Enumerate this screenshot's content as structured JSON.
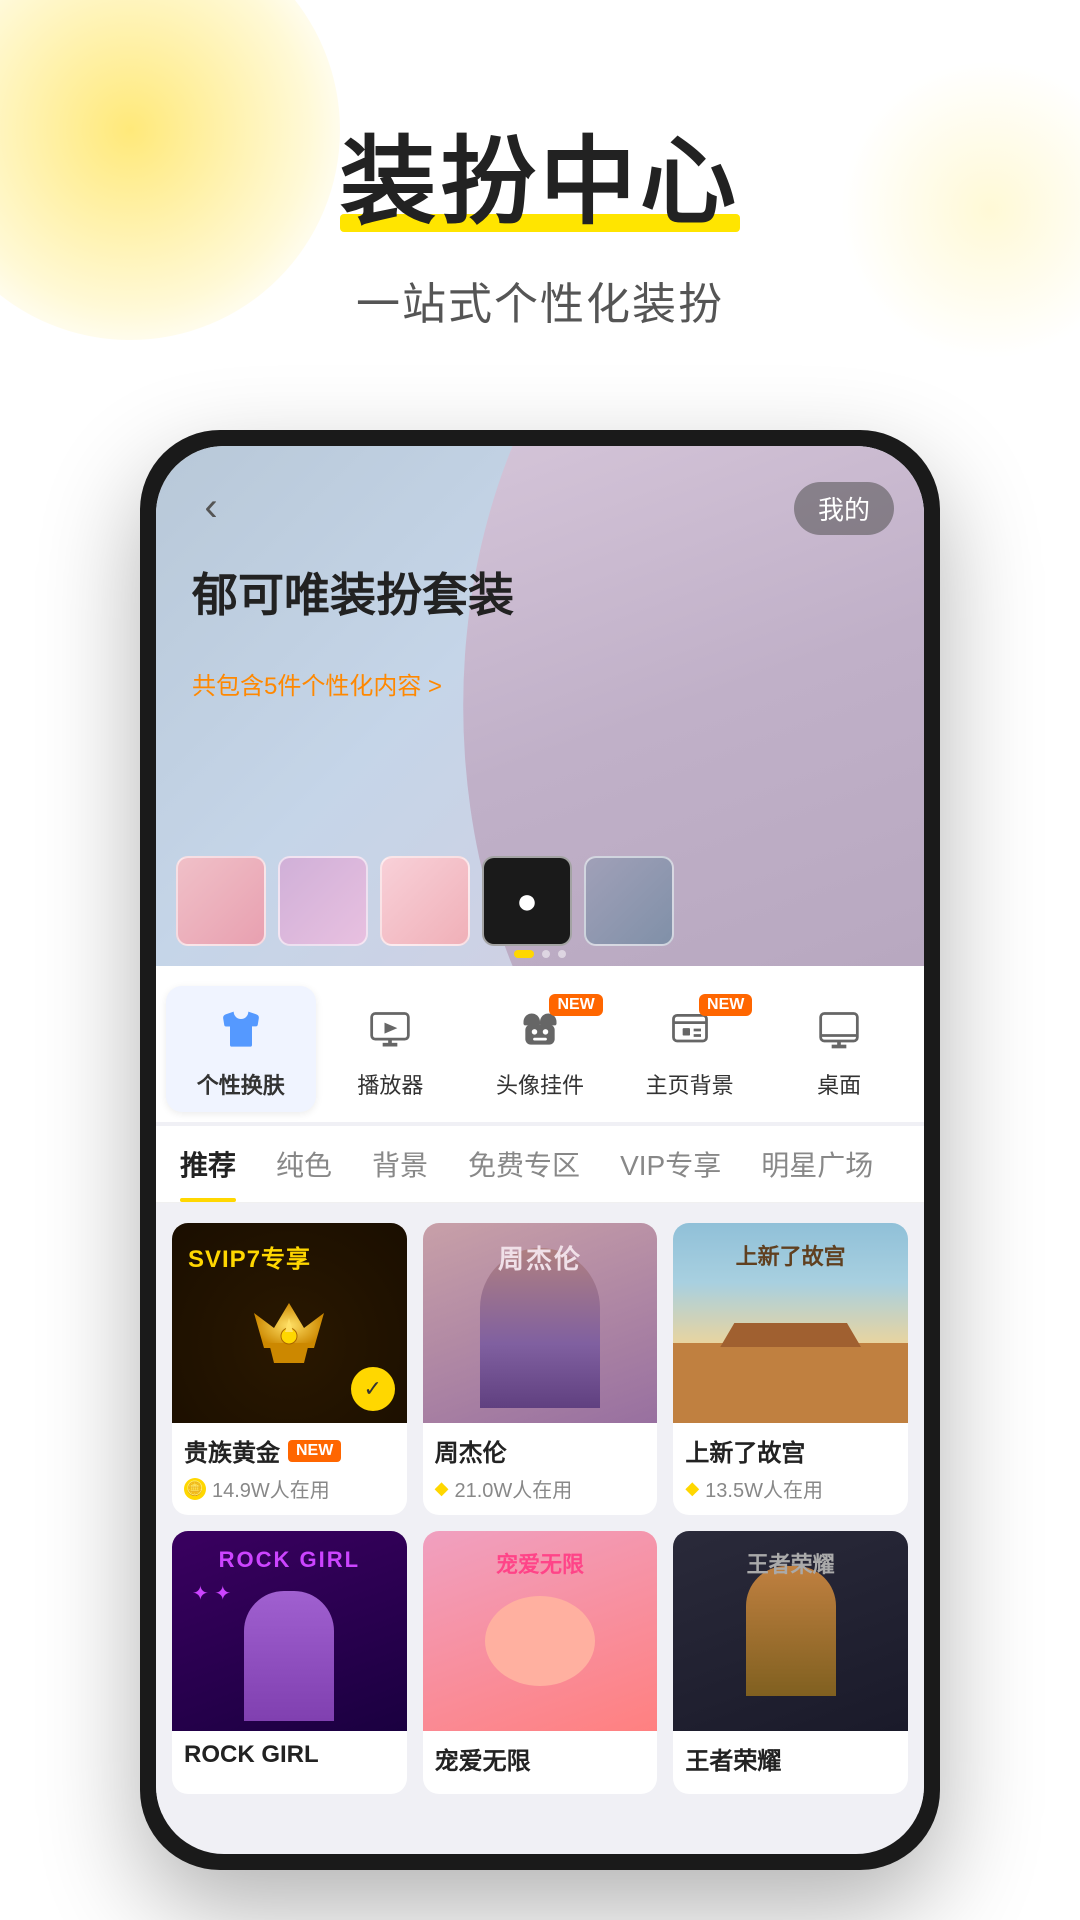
{
  "page": {
    "title": "装扮中心",
    "subtitle": "一站式个性化装扮"
  },
  "phone": {
    "hero": {
      "back_label": "‹",
      "my_label": "我的",
      "title": "郁可唯装扮套装",
      "subtitle_prefix": "共包含5件个性化内容",
      "subtitle_suffix": ">"
    },
    "categories": [
      {
        "id": "skin",
        "label": "个性换肤",
        "icon": "shirt",
        "active": true,
        "new": false
      },
      {
        "id": "player",
        "label": "播放器",
        "icon": "play",
        "active": false,
        "new": false
      },
      {
        "id": "avatar",
        "label": "头像挂件",
        "icon": "cat-head",
        "active": false,
        "new": true
      },
      {
        "id": "homebg",
        "label": "主页背景",
        "icon": "home",
        "active": false,
        "new": true
      },
      {
        "id": "desktop",
        "label": "桌面",
        "icon": "desktop",
        "active": false,
        "new": false
      }
    ],
    "filters": [
      {
        "id": "recommend",
        "label": "推荐",
        "active": true
      },
      {
        "id": "solid",
        "label": "纯色",
        "active": false
      },
      {
        "id": "bg",
        "label": "背景",
        "active": false
      },
      {
        "id": "free",
        "label": "免费专区",
        "active": false
      },
      {
        "id": "vip",
        "label": "VIP专享",
        "active": false
      },
      {
        "id": "star",
        "label": "明星广场",
        "active": false
      }
    ],
    "skins": [
      {
        "id": "noble-gold",
        "name": "贵族黄金",
        "tag": "NEW",
        "svip_label": "SVIP7专享",
        "users": "14.9W人在用",
        "coin_type": "gold",
        "selected": true,
        "type": "gold"
      },
      {
        "id": "zhou-jielun",
        "name": "周杰伦",
        "tag": "",
        "label": "周杰伦",
        "users": "21.0W人在用",
        "coin_type": "diamond",
        "selected": false,
        "type": "zjl"
      },
      {
        "id": "forbidden-city",
        "name": "上新了故宫",
        "tag": "",
        "label": "上新了故宫",
        "users": "13.5W人在用",
        "coin_type": "diamond",
        "selected": false,
        "type": "palace"
      },
      {
        "id": "rock-girl",
        "name": "ROCK GIRL",
        "tag": "",
        "label": "ROCK GIRL",
        "users": "",
        "coin_type": "",
        "selected": false,
        "type": "rock"
      },
      {
        "id": "pet-love",
        "name": "宠爱无限",
        "tag": "",
        "label": "宠爱无限",
        "users": "",
        "coin_type": "",
        "selected": false,
        "type": "pet"
      },
      {
        "id": "king-glory",
        "name": "王者荣耀",
        "tag": "",
        "label": "王者荣耀",
        "users": "",
        "coin_type": "",
        "selected": false,
        "type": "wz"
      }
    ]
  },
  "new_badge_label": "NEW",
  "icons": {
    "back": "‹",
    "check": "✓"
  }
}
